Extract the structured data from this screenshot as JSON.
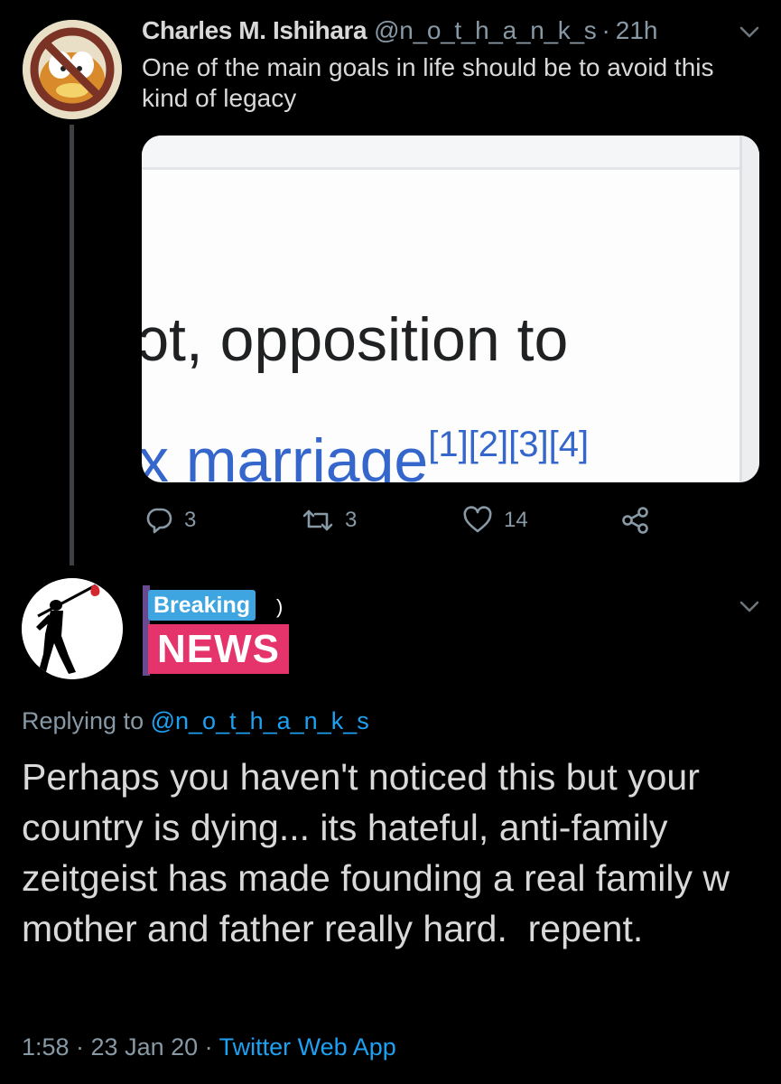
{
  "tweet1": {
    "display_name": "Charles M. Ishihara",
    "handle": "@n_o_t_h_a_n_k_s",
    "time": "21h",
    "text": "One of the main goals in life should be to avoid this kind of legacy",
    "media": {
      "line1": "ɔt, opposition to",
      "line2_main": "x marriage",
      "line2_refs": "[1][2][3][4]"
    },
    "actions": {
      "replies": "3",
      "retweets": "3",
      "likes": "14"
    }
  },
  "tweet2": {
    "banner_breaking": "Breaking",
    "banner_extra": ")",
    "banner_news": "NEWS",
    "replying_prefix": "Replying to",
    "replying_handle": "@n_o_t_h_a_n_k_s",
    "text": "Perhaps you haven't noticed this but your country is dying... its hateful, anti-family zeitgeist has made founding a real family w mother and father really hard.  repent.",
    "timestamp": "1:58 · 23 Jan 20 ·",
    "source": "Twitter Web App"
  },
  "icons": {
    "reply": "reply-icon",
    "retweet": "retweet-icon",
    "like": "heart-icon",
    "share": "share-icon",
    "caret": "chevron-down-icon"
  },
  "colors": {
    "background": "#000000",
    "text": "#d9d9d9",
    "secondary": "#8899a6",
    "link": "#1da1f2",
    "breaking_blue": "#3fa5e0",
    "news_pink": "#e5336b"
  }
}
